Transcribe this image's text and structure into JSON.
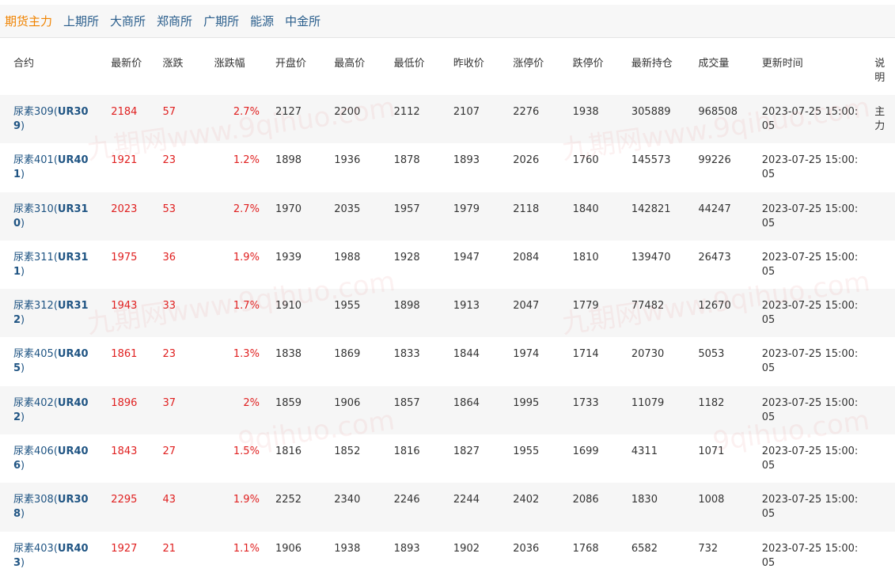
{
  "tabs": [
    {
      "label": "期货主力",
      "active": true
    },
    {
      "label": "上期所",
      "active": false
    },
    {
      "label": "大商所",
      "active": false
    },
    {
      "label": "郑商所",
      "active": false
    },
    {
      "label": "广期所",
      "active": false
    },
    {
      "label": "能源",
      "active": false
    },
    {
      "label": "中金所",
      "active": false
    }
  ],
  "colors": {
    "active_tab": "#f08300",
    "tab": "#2a5e8c",
    "up": "#e02020",
    "contract": "#1f5483"
  },
  "columns": [
    "合约",
    "最新价",
    "涨跌",
    "涨跌幅",
    "开盘价",
    "最高价",
    "最低价",
    "昨收价",
    "涨停价",
    "跌停价",
    "最新持仓",
    "成交量",
    "更新时间",
    "说明"
  ],
  "rows": [
    {
      "name": "尿素309",
      "code": "UR309",
      "last": "2184",
      "chg": "57",
      "pct": "2.7%",
      "open": "2127",
      "high": "2200",
      "low": "2112",
      "prev": "2107",
      "limit_up": "2276",
      "limit_down": "1938",
      "oi": "305889",
      "vol": "968508",
      "time": "2023-07-25 15:00:05",
      "note": "主力"
    },
    {
      "name": "尿素401",
      "code": "UR401",
      "last": "1921",
      "chg": "23",
      "pct": "1.2%",
      "open": "1898",
      "high": "1936",
      "low": "1878",
      "prev": "1893",
      "limit_up": "2026",
      "limit_down": "1760",
      "oi": "145573",
      "vol": "99226",
      "time": "2023-07-25 15:00:05",
      "note": ""
    },
    {
      "name": "尿素310",
      "code": "UR310",
      "last": "2023",
      "chg": "53",
      "pct": "2.7%",
      "open": "1970",
      "high": "2035",
      "low": "1957",
      "prev": "1979",
      "limit_up": "2118",
      "limit_down": "1840",
      "oi": "142821",
      "vol": "44247",
      "time": "2023-07-25 15:00:05",
      "note": ""
    },
    {
      "name": "尿素311",
      "code": "UR311",
      "last": "1975",
      "chg": "36",
      "pct": "1.9%",
      "open": "1939",
      "high": "1988",
      "low": "1928",
      "prev": "1947",
      "limit_up": "2084",
      "limit_down": "1810",
      "oi": "139470",
      "vol": "26473",
      "time": "2023-07-25 15:00:05",
      "note": ""
    },
    {
      "name": "尿素312",
      "code": "UR312",
      "last": "1943",
      "chg": "33",
      "pct": "1.7%",
      "open": "1910",
      "high": "1955",
      "low": "1898",
      "prev": "1913",
      "limit_up": "2047",
      "limit_down": "1779",
      "oi": "77482",
      "vol": "12670",
      "time": "2023-07-25 15:00:05",
      "note": ""
    },
    {
      "name": "尿素405",
      "code": "UR405",
      "last": "1861",
      "chg": "23",
      "pct": "1.3%",
      "open": "1838",
      "high": "1869",
      "low": "1833",
      "prev": "1844",
      "limit_up": "1974",
      "limit_down": "1714",
      "oi": "20730",
      "vol": "5053",
      "time": "2023-07-25 15:00:05",
      "note": ""
    },
    {
      "name": "尿素402",
      "code": "UR402",
      "last": "1896",
      "chg": "37",
      "pct": "2%",
      "open": "1859",
      "high": "1906",
      "low": "1857",
      "prev": "1864",
      "limit_up": "1995",
      "limit_down": "1733",
      "oi": "11079",
      "vol": "1182",
      "time": "2023-07-25 15:00:05",
      "note": ""
    },
    {
      "name": "尿素406",
      "code": "UR406",
      "last": "1843",
      "chg": "27",
      "pct": "1.5%",
      "open": "1816",
      "high": "1852",
      "low": "1816",
      "prev": "1827",
      "limit_up": "1955",
      "limit_down": "1699",
      "oi": "4311",
      "vol": "1071",
      "time": "2023-07-25 15:00:05",
      "note": ""
    },
    {
      "name": "尿素308",
      "code": "UR308",
      "last": "2295",
      "chg": "43",
      "pct": "1.9%",
      "open": "2252",
      "high": "2340",
      "low": "2246",
      "prev": "2244",
      "limit_up": "2402",
      "limit_down": "2086",
      "oi": "1830",
      "vol": "1008",
      "time": "2023-07-25 15:00:05",
      "note": ""
    },
    {
      "name": "尿素403",
      "code": "UR403",
      "last": "1927",
      "chg": "21",
      "pct": "1.1%",
      "open": "1906",
      "high": "1938",
      "low": "1893",
      "prev": "1902",
      "limit_up": "2036",
      "limit_down": "1768",
      "oi": "6582",
      "vol": "732",
      "time": "2023-07-25 15:00:05",
      "note": ""
    }
  ]
}
